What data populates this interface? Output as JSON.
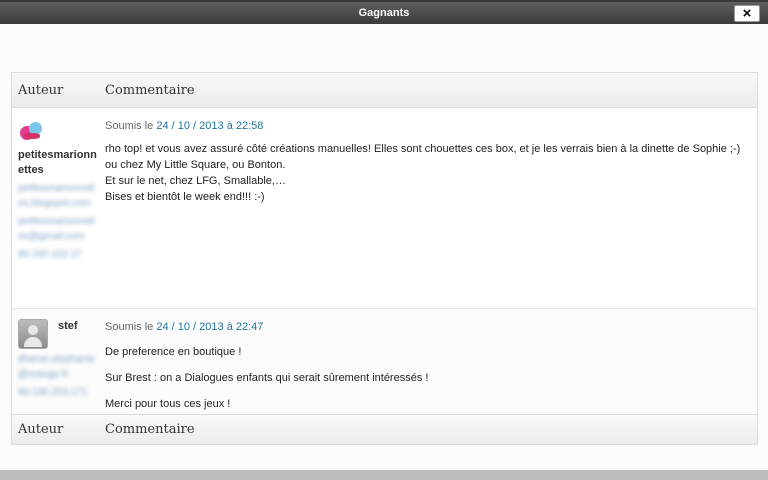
{
  "window": {
    "title": "Gagnants",
    "close_label": "×"
  },
  "table": {
    "header": {
      "author": "Auteur",
      "comment": "Commentaire"
    },
    "footer": {
      "author": "Auteur",
      "comment": "Commentaire"
    }
  },
  "comments": [
    {
      "name": "petitesmarionnettes",
      "avatar": "bird-avatar-icon",
      "meta_prefix": "Soumis le",
      "date": "24 / 10 / 2013 à 22:58",
      "blurred": [
        "petitesmarionnettes.blogspot.com",
        "petitesmarionnettes@gmail.com",
        "90.160.102.27"
      ],
      "lines": [
        "rho top! et vous avez assuré côté créations manuelles! Elles sont chouettes ces box, et je les verrais bien à la dinette de Sophie ;-) ou chez My Little Square, ou Bonton.",
        "Et sur le net, chez LFG, Smallable,…",
        "Bises et bientôt le week end!!! :-)"
      ]
    },
    {
      "name": "stef",
      "avatar": "default-avatar-icon",
      "meta_prefix": "Soumis le",
      "date": "24 / 10 / 2013 à 22:47",
      "blurred": [
        "dherve.stephanie@orange.fr",
        "90.135.253.171"
      ],
      "paragraphs": [
        "De preference en boutique !",
        "Sur Brest : on a Dialogues enfants qui serait sûrement intéressés !",
        "Merci pour tous ces jeux !"
      ]
    }
  ]
}
